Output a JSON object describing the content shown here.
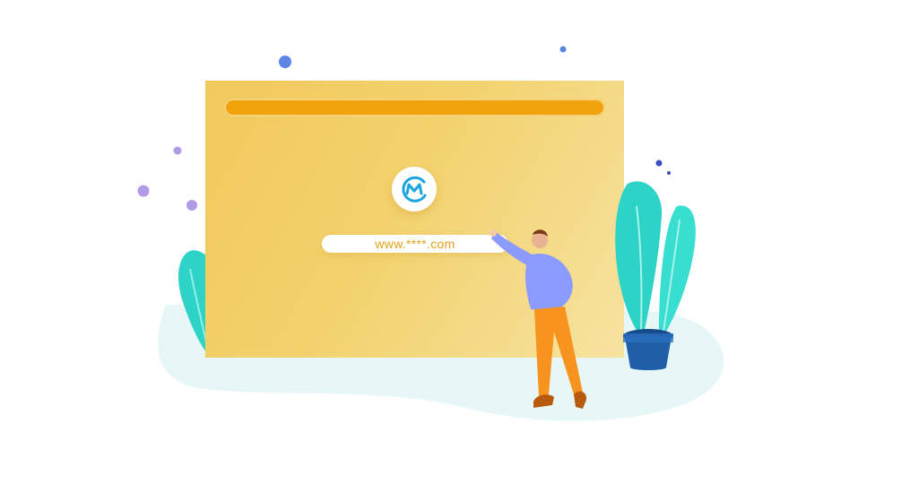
{
  "url": {
    "prefix": "www.",
    "masked": "****",
    "suffix": ".com"
  },
  "logo": {
    "icon": "brand-m-logo-icon"
  },
  "colors": {
    "panel": "#f3d26d",
    "address_bar": "#f0a30a",
    "url_text": "#e4a21a",
    "leaf": "#2dd3c6",
    "pot": "#1f5fa8",
    "shirt": "#8b9bff",
    "pants": "#f7931e"
  }
}
